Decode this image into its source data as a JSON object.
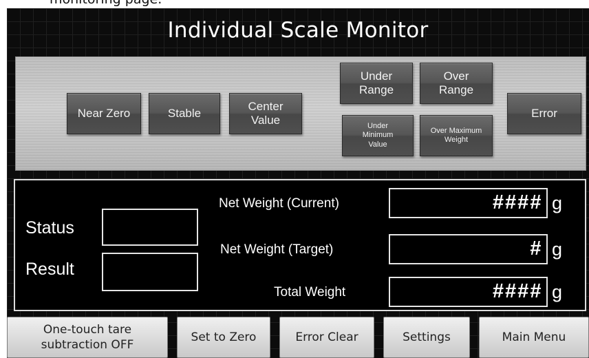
{
  "caption_fragment": "monitoring page.",
  "title": "Individual Scale Monitor",
  "lamps": {
    "near_zero": "Near Zero",
    "stable": "Stable",
    "center_value": "Center\nValue",
    "under_range": "Under\nRange",
    "over_range": "Over\nRange",
    "under_minimum_value": "Under\nMinimum\nValue",
    "over_maximum_weight": "Over Maximum\nWeight",
    "error": "Error"
  },
  "status": {
    "status_label": "Status",
    "result_label": "Result"
  },
  "weights": {
    "net_current_label": "Net Weight (Current)",
    "net_current_value": "####",
    "net_target_label": "Net Weight (Target)",
    "net_target_value": "#",
    "total_label": "Total Weight",
    "total_value": "####",
    "unit": "g"
  },
  "buttons": {
    "tare": "One-touch tare\nsubtraction OFF",
    "set_zero": "Set to Zero",
    "error_clear": "Error Clear",
    "settings": "Settings",
    "main_menu": "Main Menu"
  }
}
